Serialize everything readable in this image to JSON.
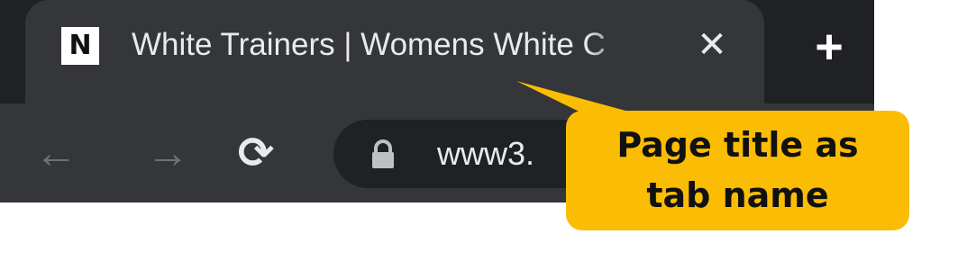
{
  "tab": {
    "favicon_letter": "N",
    "title": "White Trainers | Womens White C",
    "close_icon": "close-icon",
    "new_tab_icon": "plus-icon"
  },
  "toolbar": {
    "back_icon": "arrow-left-icon",
    "forward_icon": "arrow-right-icon",
    "reload_icon": "reload-icon",
    "lock_icon": "lock-icon",
    "url_visible": "www3."
  },
  "callout": {
    "line1": "Page title as",
    "line2": "tab name",
    "color": "#fbbd03"
  },
  "colors": {
    "frame": "#202124",
    "tab_active": "#35363a",
    "text": "#e8eaed"
  }
}
